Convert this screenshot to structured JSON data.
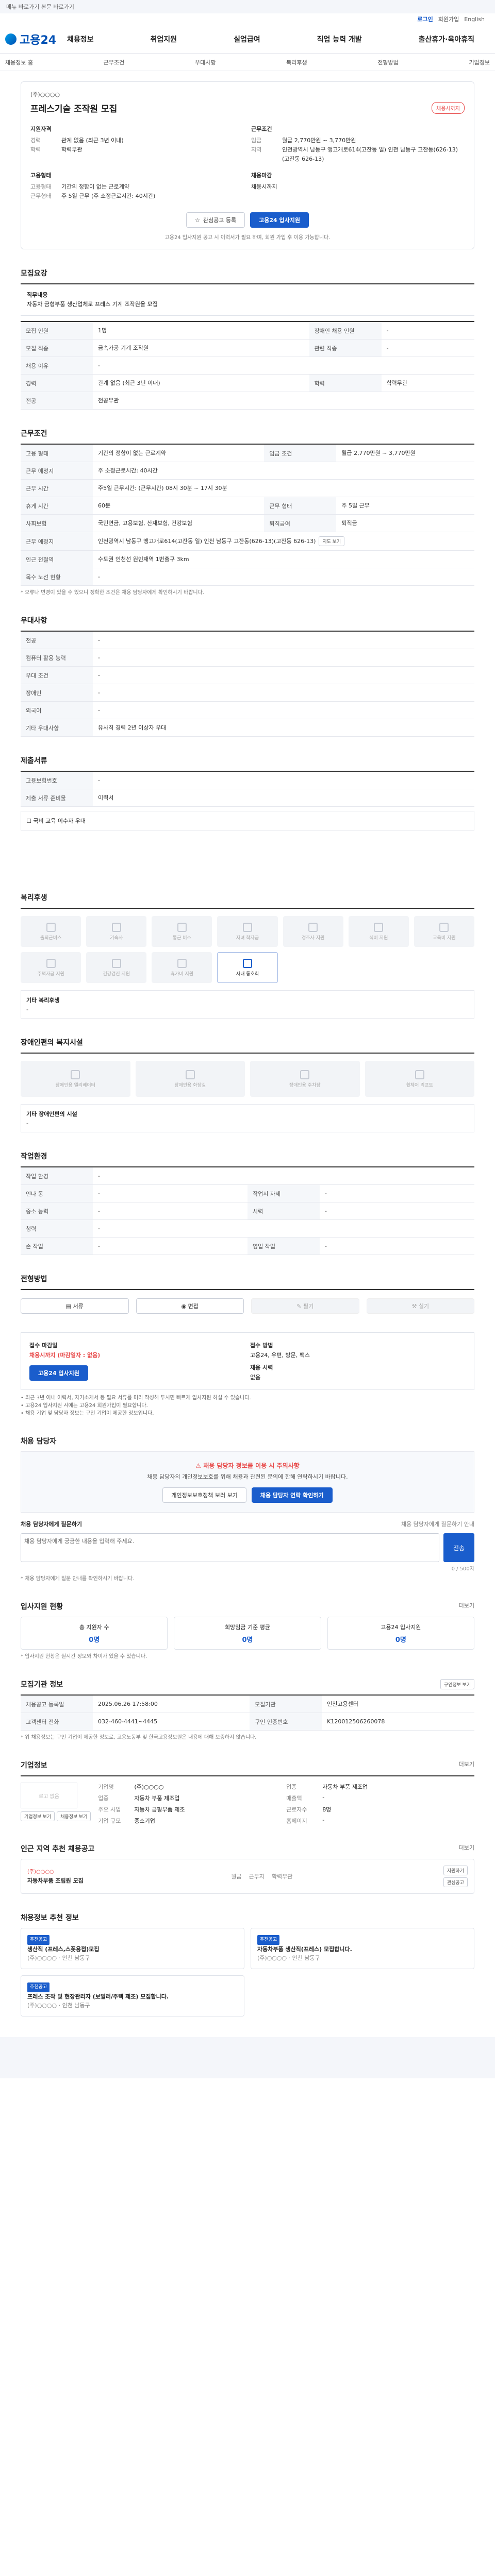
{
  "topbar": {
    "skip": "메뉴 바로가기 본문 바로가기"
  },
  "util": {
    "login": "로그인",
    "join": "회원가입",
    "lang": "English"
  },
  "header": {
    "logo": "고용24",
    "gnb": [
      "채용정보",
      "취업지원",
      "실업급여",
      "직업 능력 개발",
      "출산휴가·육아휴직"
    ]
  },
  "subnav": [
    "채용정보 홈",
    "근무조건",
    "우대사항",
    "복리후생",
    "전형방법",
    "기업정보"
  ],
  "job": {
    "company": "(주)○○○○",
    "title": "프레스기술 조작원 모집",
    "badge": "채용시까지",
    "apply_title": "지원자격",
    "apply": [
      {
        "k": "경력",
        "v": "관계 없음 (최근 3년 이내)"
      },
      {
        "k": "학력",
        "v": "학력무관"
      }
    ],
    "cond_title": "근무조건",
    "cond": [
      {
        "k": "임금",
        "v": "월급 2,770만원 ~ 3,770만원"
      },
      {
        "k": "지역",
        "v": "인천광역시 남동구 앵고개로614(고잔동 일) 인천 남동구 고잔동(626-13)(고잔동 626-13)"
      }
    ],
    "type_title": "고용형태",
    "type": [
      {
        "k": "고용형태",
        "v": "기간의 정함이 없는 근로계약"
      },
      {
        "k": "근무형태",
        "v": "주 5일 근무 (주 소정근로시간: 40시간)"
      }
    ],
    "deadline_title": "채용마감",
    "deadline": "채용시까지",
    "btn_scrap": "관심공고 등록",
    "btn_apply": "고용24 입사지원",
    "notice": "고용24 입사지원 공고 시 이력서가 필요 하며, 회원 가입 후 이용 가능합니다."
  },
  "recruit": {
    "title": "모집요강",
    "desc_label": "직무내용",
    "desc": "자동차 금형부품 생산업체로 프레스 기계 조작원을 모집",
    "rows": [
      {
        "k": "모집 인원",
        "v": "1명",
        "k2": "장애인 채용 인원",
        "v2": "-"
      },
      {
        "k": "모집 직종",
        "v": "금속가공 기계 조작원",
        "k2": "관련 직종",
        "v2": "-"
      },
      {
        "k": "채용 이유",
        "v": "-",
        "k2": "",
        "v2": ""
      },
      {
        "k": "경력",
        "v": "관계 없음 (최근 3년 이내)",
        "k2": "학력",
        "v2": "학력무관"
      },
      {
        "k": "전공",
        "v": "전공무관",
        "k2": "",
        "v2": ""
      }
    ]
  },
  "work": {
    "title": "근무조건",
    "rows": [
      {
        "k": "고용 형태",
        "v": "기간의 정함이 없는 근로계약",
        "k2": "임금 조건",
        "v2": "월급 2,770만원 ~ 3,770만원"
      },
      {
        "k": "근무 예정지",
        "v": "주 소정근로시간: 40시간",
        "k2": "",
        "v2": ""
      },
      {
        "k": "근무 시간",
        "v": "주5일 근무시간: (근무시간) 08시 30분 ~ 17시 30분",
        "k2": "",
        "v2": ""
      },
      {
        "k": "휴게 시간",
        "v": "60분",
        "k2": "근무 형태",
        "v2": "주 5일 근무"
      },
      {
        "k": "사회보험",
        "v": "국민연금, 고용보험, 산재보험, 건강보험",
        "k2": "퇴직급여",
        "v2": "퇴직금"
      },
      {
        "k": "근무 예정지",
        "v": "인천광역시 남동구 앵고개로614(고잔동 일) 인천 남동구 고잔동(626-13)(고잔동 626-13)",
        "k2": "",
        "v2": ""
      },
      {
        "k": "인근 전철역",
        "v": "수도권 인천선 원인재역 1번출구 3km",
        "k2": "",
        "v2": ""
      },
      {
        "k": "목수 노선 현황",
        "v": "-",
        "k2": "",
        "v2": ""
      }
    ],
    "map_btn": "지도 보기",
    "footnote": "* 오류나 변경이 있을 수 있으니 정확한 조건은 채용 담당자에게 확인하시기 바랍니다."
  },
  "prefer": {
    "title": "우대사항",
    "rows": [
      {
        "k": "전공",
        "v": "-"
      },
      {
        "k": "컴퓨터 활용 능력",
        "v": "-"
      },
      {
        "k": "우대 조건",
        "v": "-"
      },
      {
        "k": "장애인",
        "v": "-"
      },
      {
        "k": "외국어",
        "v": "-"
      },
      {
        "k": "기타 우대사항",
        "v": "유사직 경력 2년 이상자 우대"
      }
    ]
  },
  "docs": {
    "title": "제출서류",
    "rows": [
      {
        "k": "고용보험번호",
        "v": "-"
      },
      {
        "k": "제출 서류 준비물",
        "v": "이력서"
      }
    ],
    "check_label": "국비 교육 이수자 우대"
  },
  "welfare": {
    "title": "복리후생",
    "items": [
      {
        "name": "출퇴근버스",
        "on": false
      },
      {
        "name": "기숙사",
        "on": false
      },
      {
        "name": "통근 버스",
        "on": false
      },
      {
        "name": "자녀 학자금",
        "on": false
      },
      {
        "name": "경조사 지원",
        "on": false
      },
      {
        "name": "식비 지원",
        "on": false
      },
      {
        "name": "교육비 지원",
        "on": false
      },
      {
        "name": "주택자금 지원",
        "on": false
      },
      {
        "name": "건강검진 지원",
        "on": false
      },
      {
        "name": "휴가비 지원",
        "on": false
      },
      {
        "name": "사내 동호회",
        "on": true
      }
    ],
    "etc_label": "기타 복리후생",
    "etc": "-"
  },
  "disabled": {
    "title": "장애인편의 복지시설",
    "items": [
      "장애인용 엘리베이터",
      "장애인용 화장실",
      "장애인용 주차장",
      "휠체어 리프트"
    ],
    "etc_label": "기타 장애인편의 시설",
    "etc": "-"
  },
  "environment": {
    "title": "작업환경",
    "rows": [
      {
        "k": "작업 환경",
        "v": "-",
        "k2": "",
        "v2": ""
      },
      {
        "k": "인나 동",
        "v": "-",
        "k2": "작업시 자세",
        "v2": "-"
      },
      {
        "k": "중소 능력",
        "v": "-",
        "k2": "시력",
        "v2": "-"
      },
      {
        "k": "청력",
        "v": "-",
        "k2": "",
        "v2": ""
      },
      {
        "k": "손 작업",
        "v": "-",
        "k2": "영업 작업",
        "v2": "-"
      }
    ]
  },
  "process": {
    "title": "전형방법",
    "steps": [
      {
        "name": "서류",
        "on": true
      },
      {
        "name": "면접",
        "on": true
      },
      {
        "name": "필기",
        "on": false
      },
      {
        "name": "실기",
        "on": false
      }
    ]
  },
  "howto": {
    "title": "접수 마감일",
    "deadline": "채용시까지 (마감일자 : 없음)",
    "how_title": "접수 방법",
    "how": "고용24, 우편, 방문, 팩스",
    "count_title": "채용 시력",
    "count": "없음",
    "apply_btn": "고용24 입사지원",
    "notes": [
      "• 최근 3년 이내 이력서, 자기소개서 등 필요 서류를 미리 작성해 두시면 빠르게 입사지원 하실 수 있습니다.",
      "• 고용24 입사지원 시에는 고용24 회원가입이 필요합니다.",
      "• 채용 기업 및 담당자 정보는 구인 기업이 제공한 정보입니다."
    ]
  },
  "manager": {
    "title": "채용 담당자",
    "warn": "채용 담당자 정보를 이용 시 주의사항",
    "desc": "채용 담당자의 개인정보보호를 위해 채용과 관련된 문의에 한해 연락하시기 바랍니다.",
    "btn_call": "개인정보보호정책 보러 보기",
    "btn_inquiry": "채용 담당자 연락 확인하기",
    "inquiry_label": "채용 담당자에게 질문하기",
    "inquiry_note": "채용 담당자에게 질문하기 안내",
    "placeholder": "채용 담당자에게 궁금한 내용을 입력해 주세요.",
    "send": "전송",
    "counter": "0 / 500자",
    "footnote": "* 채용 담당자에게 질문 안내를 확인하시기 바랍니다."
  },
  "status": {
    "title": "입사지원 현황",
    "more": "더보기",
    "cards": [
      {
        "label": "총 지원자 수",
        "num": "0명"
      },
      {
        "label": "희망임금 기준 평균",
        "num": "0명"
      },
      {
        "label": "고용24 입사지원",
        "num": "0명"
      }
    ],
    "footnote": "* 입사지원 현황은 실시간 정보와 차이가 있을 수 있습니다."
  },
  "info": {
    "title": "모집기관 정보",
    "btn": "구인정보 보기",
    "rows": [
      {
        "k": "채용공고 등록일",
        "v": "2025.06.26 17:58:00",
        "k2": "모집기관",
        "v2": "인천고용센터"
      },
      {
        "k": "고객센터 전화",
        "v": "032-460-4441~4445",
        "k2": "구인 인증번호",
        "v2": "K120012506260078"
      }
    ],
    "footnote": "* 위 채용정보는 구인 기업이 제공한 정보로, 고용노동부 및 한국고용정보원은 내용에 대해 보증하지 않습니다."
  },
  "company": {
    "title": "기업정보",
    "more": "더보기",
    "logo": "로고 없음",
    "rows": [
      {
        "k": "기업명",
        "v": "(주)○○○○",
        "k2": "업종",
        "v2": "자동차 부품 제조업"
      },
      {
        "k": "업종",
        "v": "자동차 부품 제조업",
        "k2": "매출액",
        "v2": "-"
      },
      {
        "k": "주요 사업",
        "v": "자동차 금형부품 제조",
        "k2": "근로자수",
        "v2": "8명"
      },
      {
        "k": "기업 규모",
        "v": "중소기업",
        "k2": "홈페이지",
        "v2": "-"
      }
    ],
    "btn1": "기업정보 보기",
    "btn2": "채용정보 보기"
  },
  "nearby": {
    "title": "인근 지역 추천 채용공고",
    "more": "더보기",
    "company": "(주)○○○○",
    "job": "자동차부품 조립원 모집",
    "meta": [
      "월급",
      "근무지",
      "학력무관"
    ],
    "btn1": "지원하기",
    "btn2": "관심공고"
  },
  "recommend": {
    "title": "채용정보 추천 정보",
    "items": [
      {
        "tag": "추천공고",
        "ttl": "생산직 (프레스,스폿용접)모집",
        "sub": "(주)○○○○  ·  인천 남동구"
      },
      {
        "tag": "추천공고",
        "ttl": "자동차부품 생산직(프레스) 모집합니다.",
        "sub": "(주)○○○○  ·  인천 남동구"
      },
      {
        "tag": "추천공고",
        "ttl": "프레스 조작 및 현장관리자 (보일러/주택 제조) 모집합니다.",
        "sub": "(주)○○○○  ·  인천 남동구"
      }
    ]
  }
}
